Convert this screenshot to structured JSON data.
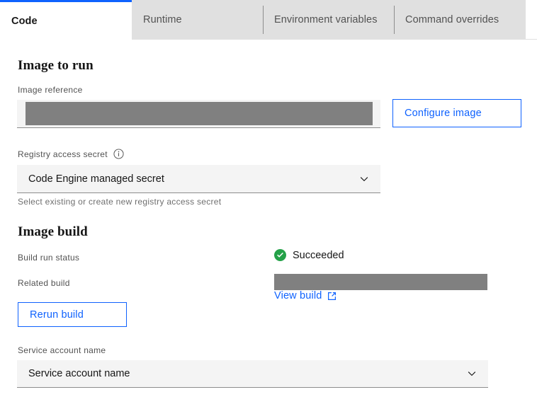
{
  "tabs": [
    {
      "label": "Code",
      "active": true
    },
    {
      "label": "Runtime",
      "active": false
    },
    {
      "label": "Environment variables",
      "active": false
    },
    {
      "label": "Command overrides",
      "active": false
    }
  ],
  "image_to_run": {
    "heading": "Image to run",
    "image_reference": {
      "label": "Image reference",
      "value": "",
      "redacted": true
    },
    "configure_image_button": "Configure image",
    "registry_access_secret": {
      "label": "Registry access secret",
      "info_icon": "info-icon",
      "selected": "Code Engine managed secret",
      "helper_text": "Select existing or create new registry access secret",
      "chevron_icon": "chevron-down-icon"
    }
  },
  "image_build": {
    "heading": "Image build",
    "build_run_status": {
      "label": "Build run status",
      "status": "Succeeded",
      "status_icon": "checkmark-filled-icon",
      "status_color": "#24a148"
    },
    "related_build": {
      "label": "Related build",
      "value": "",
      "redacted": true,
      "view_build_link": "View build",
      "external_link_icon": "launch-icon"
    },
    "rerun_build_button": "Rerun build"
  },
  "service_account": {
    "label": "Service account name",
    "selected": "Service account name",
    "chevron_icon": "chevron-down-icon"
  },
  "colors": {
    "accent": "#0f62fe",
    "success": "#24a148",
    "field_bg": "#f4f4f4",
    "tab_inactive": "#e0e0e0",
    "redaction": "#808080"
  }
}
